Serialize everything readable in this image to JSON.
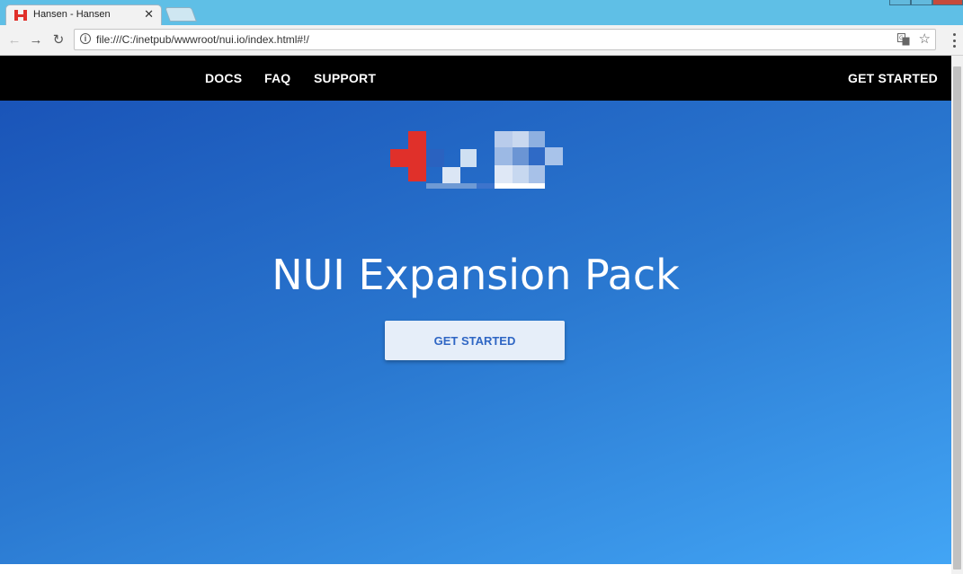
{
  "browser": {
    "tab_title": "Hansen - Hansen",
    "tab_close": "✕",
    "url": "file:///C:/inetpub/wwwroot/nui.io/index.html#!/",
    "back": "←",
    "forward": "→",
    "reload": "↻",
    "star": "☆",
    "info": "i"
  },
  "site": {
    "nav": {
      "docs": "DOCS",
      "faq": "FAQ",
      "support": "SUPPORT",
      "get_started": "GET STARTED"
    },
    "hero": {
      "title": "NUI Expansion Pack",
      "button": "GET STARTED"
    }
  },
  "colors": {
    "nav_background": "#000000",
    "hero_gradient_start": "#1a54b8",
    "hero_gradient_end": "#42a5f5",
    "button_text": "#2f66c4",
    "logo_red": "#e0302a"
  }
}
